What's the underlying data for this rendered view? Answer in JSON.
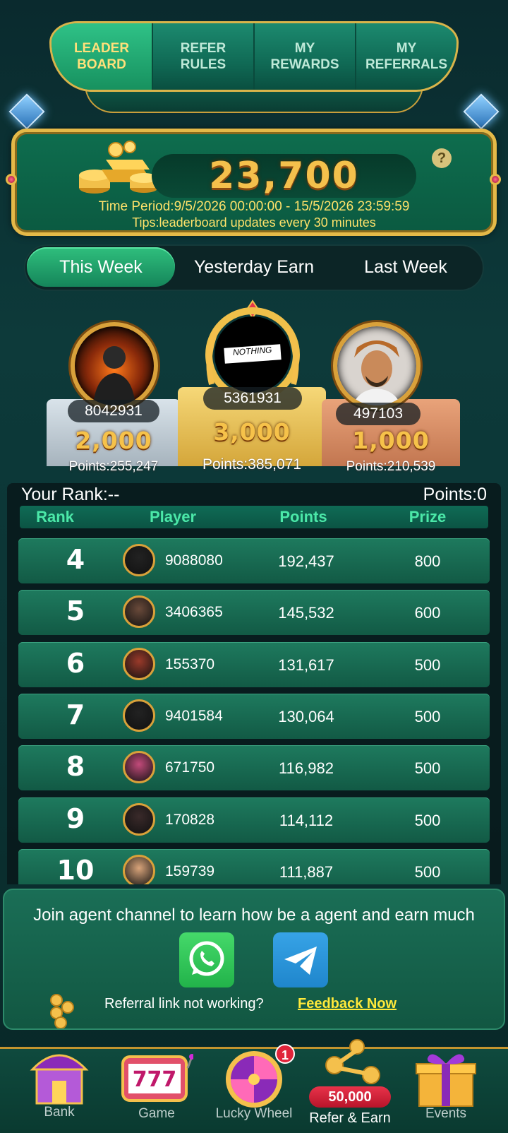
{
  "top_tabs": [
    {
      "label": "LEADER\nBOARD"
    },
    {
      "label": "REFER\nRULES"
    },
    {
      "label": "MY\nREWARDS"
    },
    {
      "label": "MY\nREFERRALS"
    }
  ],
  "pool": {
    "amount": "23,700",
    "time_period": "Time Period:9/5/2026 00:00:00 - 15/5/2026 23:59:59",
    "tips": "Tips:leaderboard updates every 30 minutes",
    "help": "?"
  },
  "period_tabs": [
    {
      "label": "This Week"
    },
    {
      "label": "Yesterday Earn"
    },
    {
      "label": "Last Week"
    }
  ],
  "podium": {
    "first": {
      "id": "5361931",
      "prize": "3,000",
      "points": "Points:385,071",
      "avatar_text": "NOTHING"
    },
    "second": {
      "id": "8042931",
      "prize": "2,000",
      "points": "Points:255,247"
    },
    "third": {
      "id": "497103",
      "prize": "1,000",
      "points": "Points:210,539"
    }
  },
  "your_rank": "Your Rank:--",
  "your_points": "Points:0",
  "list_headers": {
    "rank": "Rank",
    "player": "Player",
    "points": "Points",
    "prize": "Prize"
  },
  "rows": [
    {
      "rank": "4",
      "id": "9088080",
      "points": "192,437",
      "prize": "800"
    },
    {
      "rank": "5",
      "id": "3406365",
      "points": "145,532",
      "prize": "600"
    },
    {
      "rank": "6",
      "id": "155370",
      "points": "131,617",
      "prize": "500"
    },
    {
      "rank": "7",
      "id": "9401584",
      "points": "130,064",
      "prize": "500"
    },
    {
      "rank": "8",
      "id": "671750",
      "points": "116,982",
      "prize": "500"
    },
    {
      "rank": "9",
      "id": "170828",
      "points": "114,112",
      "prize": "500"
    },
    {
      "rank": "10",
      "id": "159739",
      "points": "111,887",
      "prize": "500"
    }
  ],
  "agent": {
    "text": "Join agent channel to learn how be a agent and earn much",
    "referral_text": "Referral link not working?",
    "feedback": "Feedback Now"
  },
  "bottom_nav": [
    {
      "label": "Bank"
    },
    {
      "label": "Game"
    },
    {
      "label": "Lucky Wheel",
      "badge": "1"
    },
    {
      "label": "Refer & Earn",
      "coins": "50,000"
    },
    {
      "label": "Events"
    }
  ],
  "colors": {
    "accent_green": "#2fbf7d",
    "gold": "#f4c04c",
    "link_yellow": "#ffe93a"
  }
}
